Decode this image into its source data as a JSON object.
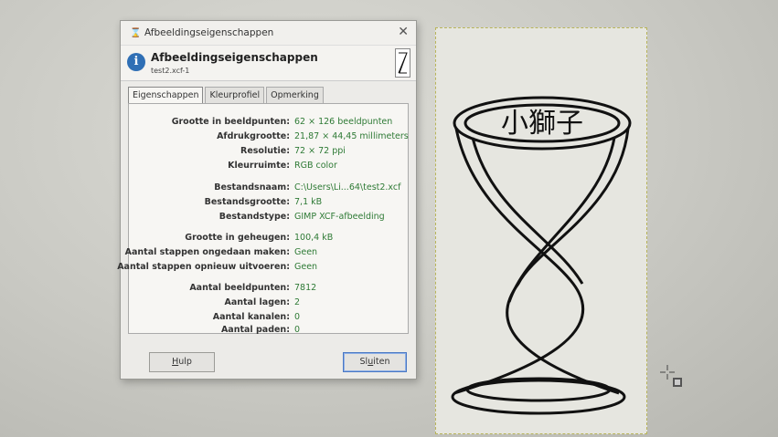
{
  "window": {
    "title": "Afbeeldingseigenschappen",
    "close_glyph": "✕"
  },
  "header": {
    "icon": "info-icon",
    "title": "Afbeeldingseigenschappen",
    "subtitle": "test2.xcf-1",
    "thumbnail_icon": "hourglass-thumbnail"
  },
  "tabs": [
    "Eigenschappen",
    "Kleurprofiel",
    "Opmerking"
  ],
  "properties": [
    {
      "label": "Grootte in beeldpunten:",
      "value": "62 × 126 beeldpunten"
    },
    {
      "label": "Afdrukgrootte:",
      "value": "21,87 × 44,45 millimeters"
    },
    {
      "label": "Resolutie:",
      "value": "72 × 72 ppi"
    },
    {
      "label": "Kleurruimte:",
      "value": "RGB color"
    },
    {
      "label": "Bestandsnaam:",
      "value": "C:\\Users\\Li...64\\test2.xcf"
    },
    {
      "label": "Bestandsgrootte:",
      "value": "7,1 kB"
    },
    {
      "label": "Bestandstype:",
      "value": "GIMP XCF-afbeelding"
    },
    {
      "label": "Grootte in geheugen:",
      "value": "100,4 kB"
    },
    {
      "label": "Aantal stappen ongedaan maken:",
      "value": "Geen"
    },
    {
      "label": "Aantal stappen opnieuw uitvoeren:",
      "value": "Geen"
    },
    {
      "label": "Aantal beeldpunten:",
      "value": "7812"
    },
    {
      "label": "Aantal lagen:",
      "value": "2"
    },
    {
      "label": "Aantal kanalen:",
      "value": "0"
    },
    {
      "label": "Aantal paden:",
      "value": "0"
    }
  ],
  "buttons": {
    "help_accel": "H",
    "help_rest": "ulp",
    "close_pre": "Sl",
    "close_accel": "u",
    "close_post": "iten"
  },
  "canvas": {
    "drawing_text": "小獅子",
    "frame_color": "#b8b45a"
  }
}
